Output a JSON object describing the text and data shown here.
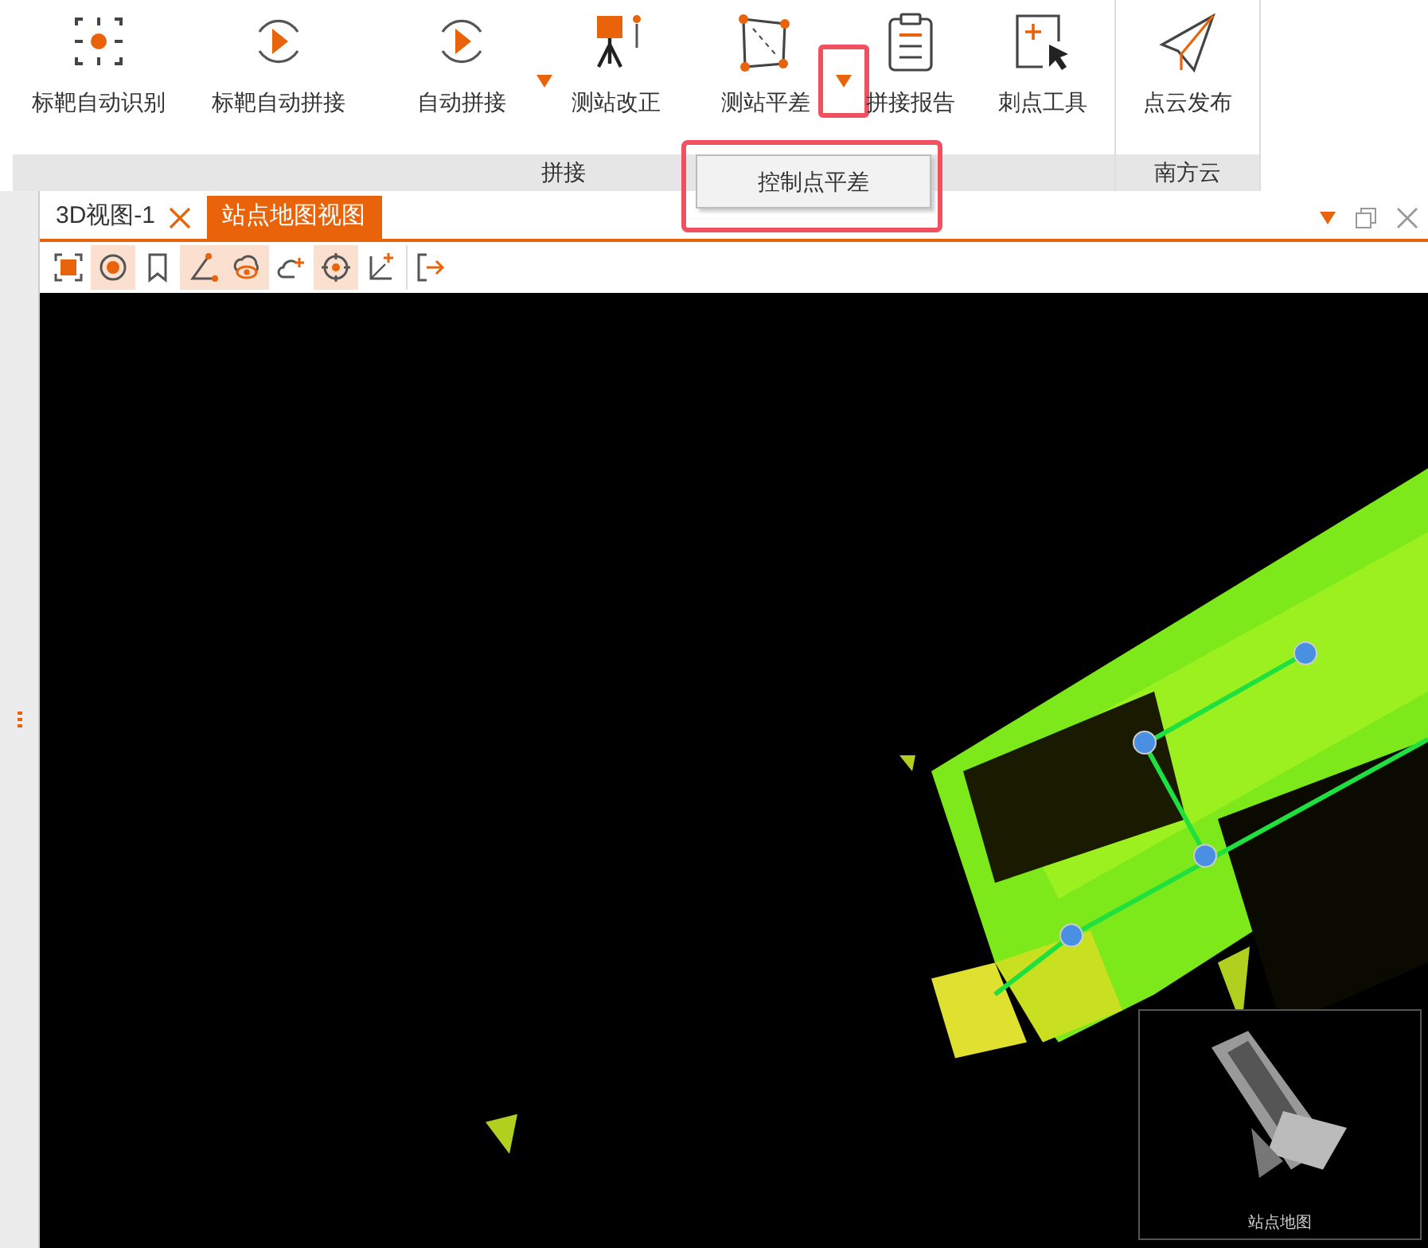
{
  "ribbon": {
    "groups": [
      {
        "label": "拼接",
        "buttons": [
          {
            "label": "标靶自动识别",
            "dropdown": false
          },
          {
            "label": "标靶自动拼接",
            "dropdown": false
          },
          {
            "label": "自动拼接",
            "dropdown": true,
            "highlighted": false
          },
          {
            "label": "测站改正",
            "dropdown": false
          },
          {
            "label": "测站平差",
            "dropdown": true,
            "highlighted": true
          },
          {
            "label": "拼接报告",
            "dropdown": false
          },
          {
            "label": "刺点工具",
            "dropdown": false
          }
        ]
      },
      {
        "label": "南方云",
        "buttons": [
          {
            "label": "点云发布",
            "dropdown": false
          }
        ]
      }
    ]
  },
  "dropdown_menu": {
    "items": [
      {
        "label": "控制点平差",
        "highlighted": true
      }
    ]
  },
  "tabs": [
    {
      "label": "3D视图-1",
      "selected": false,
      "closable": true
    },
    {
      "label": "站点地图视图",
      "selected": true,
      "closable": false
    }
  ],
  "toolbar": {
    "tools": [
      {
        "selected": false
      },
      {
        "selected": true
      },
      {
        "selected": false
      },
      {
        "selected": true
      },
      {
        "selected": true
      },
      {
        "selected": false
      },
      {
        "selected": true
      },
      {
        "selected": false
      },
      {
        "selected": false
      }
    ]
  },
  "view": {
    "kind": "picture",
    "minimap": {
      "title": "站点地图"
    }
  }
}
